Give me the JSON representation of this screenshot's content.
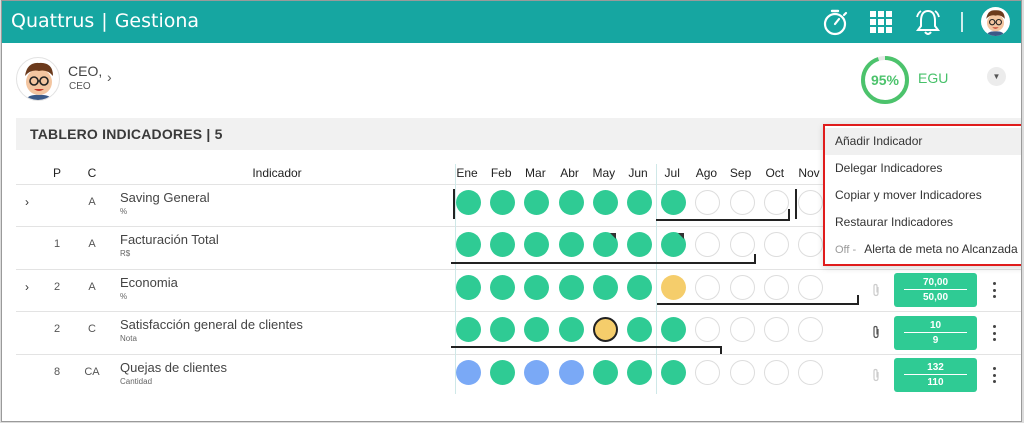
{
  "app": {
    "brand": "Quattrus",
    "brand_sep": "|",
    "product": "Gestiona",
    "icons": [
      "stopwatch-icon",
      "apps-grid-icon",
      "bell-icon",
      "user-avatar-icon"
    ]
  },
  "profile": {
    "name": "CEO,",
    "role": "CEO",
    "chevron": "›"
  },
  "gauge": {
    "value_text": "95%",
    "value": 0.95,
    "label": "EGU",
    "dropdown_icon": "chevron-down-icon",
    "color": "#4cc36c"
  },
  "board": {
    "title": "TABLERO INDICADORES | 5",
    "columns": {
      "p": "P",
      "c": "C",
      "indicator": "Indicador",
      "months": [
        "Ene",
        "Feb",
        "Mar",
        "Abr",
        "May",
        "Jun",
        "Jul",
        "Ago",
        "Sep",
        "Oct",
        "Nov"
      ]
    },
    "rows": [
      {
        "expandable": true,
        "p": "",
        "c": "A",
        "name": "Saving General",
        "unit": "%",
        "dots": [
          "green",
          "green",
          "green",
          "green",
          "green",
          "green",
          "green",
          "empty",
          "empty",
          "empty",
          "empty"
        ]
      },
      {
        "expandable": false,
        "p": "1",
        "c": "A",
        "name": "Facturación Total",
        "unit": "R$",
        "dots": [
          "green",
          "green",
          "green",
          "green",
          "green",
          "green",
          "green",
          "empty",
          "empty",
          "empty",
          "empty"
        ]
      },
      {
        "expandable": true,
        "p": "2",
        "c": "A",
        "name": "Economia",
        "unit": "%",
        "dots": [
          "green",
          "green",
          "green",
          "green",
          "green",
          "green",
          "yellow",
          "empty",
          "empty",
          "empty",
          "empty"
        ],
        "value_top": "70,00",
        "value_bottom": "50,00"
      },
      {
        "expandable": false,
        "p": "2",
        "c": "C",
        "name": "Satisfacción general de clientes",
        "unit": "Nota",
        "dots": [
          "green",
          "green",
          "green",
          "green",
          "yellow",
          "green",
          "green",
          "empty",
          "empty",
          "empty",
          "empty"
        ],
        "value_top": "10",
        "value_bottom": "9"
      },
      {
        "expandable": false,
        "p": "8",
        "c": "CA",
        "name": "Quejas de clientes",
        "unit": "Cantidad",
        "dots": [
          "blue",
          "green",
          "blue",
          "blue",
          "green",
          "green",
          "green",
          "empty",
          "empty",
          "empty",
          "empty"
        ],
        "value_top": "132",
        "value_bottom": "110"
      }
    ]
  },
  "menu": {
    "items": [
      "Añadir Indicador",
      "Delegar Indicadores",
      "Copiar y mover Indicadores",
      "Restaurar Indicadores"
    ],
    "toggle_state": "Off -",
    "toggle_label": "Alerta de meta no Alcanzada"
  },
  "colors": {
    "topbar": "#16a6a1",
    "success": "#2fcb94",
    "warning": "#f5cd6b",
    "info": "#7aa9f6",
    "menu_border": "#e01c1c"
  }
}
